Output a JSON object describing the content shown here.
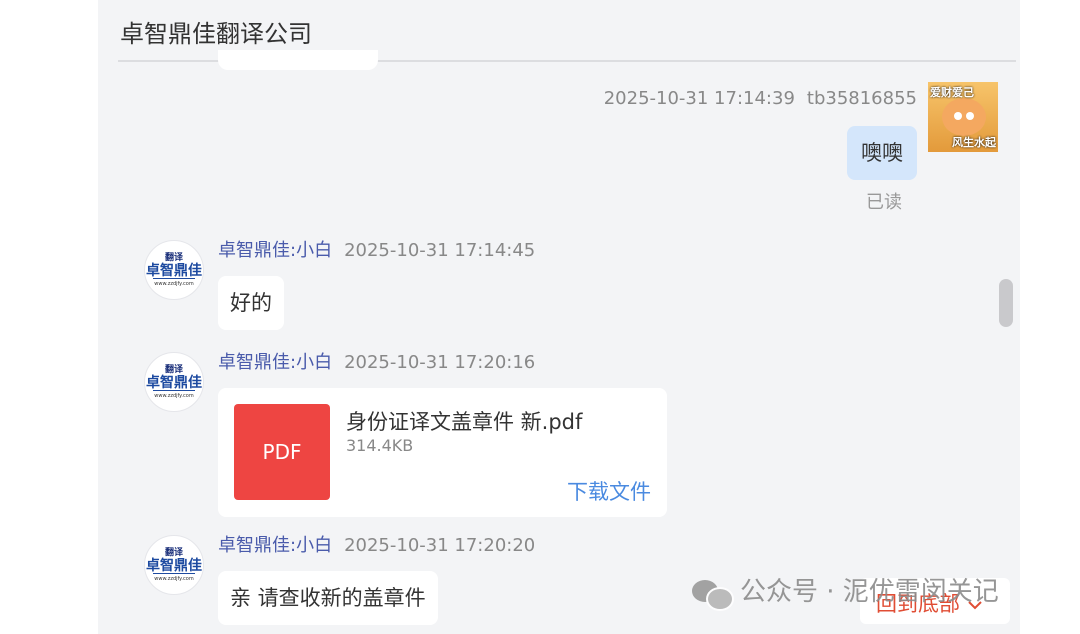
{
  "header": {
    "title": "卓智鼎佳翻译公司"
  },
  "self_message": {
    "timestamp": "2025-10-31 17:14:39",
    "username": "tb35816855",
    "text": "噢噢",
    "status": "已读",
    "avatar_text_top": "爱财爱己",
    "avatar_text_bottom": "风生水起"
  },
  "messages": [
    {
      "sender": "卓智鼎佳:小白",
      "timestamp": "2025-10-31 17:14:45",
      "text": "好的"
    },
    {
      "sender": "卓智鼎佳:小白",
      "timestamp": "2025-10-31 17:20:16",
      "file": {
        "icon_label": "PDF",
        "name": "身份证译文盖章件 新.pdf",
        "size": "314.4KB",
        "download_label": "下载文件"
      }
    },
    {
      "sender": "卓智鼎佳:小白",
      "timestamp": "2025-10-31 17:20:20",
      "text": "亲 请查收新的盖章件"
    }
  ],
  "avatar_logo": {
    "top": "翻译",
    "main": "卓智鼎佳",
    "url": "www.zzdjfy.com"
  },
  "back_to_bottom": {
    "label": "回到底部",
    "icon": "chevron-down-icon"
  },
  "watermark": {
    "text": "公众号 · 泥优雷闵关记",
    "icon": "wechat-icon"
  },
  "colors": {
    "accent": "#4a8ae0",
    "sender_name": "#4a5bab",
    "self_bubble": "#d4e6fb",
    "pdf": "#ee4542",
    "back_label": "#e04d34"
  }
}
